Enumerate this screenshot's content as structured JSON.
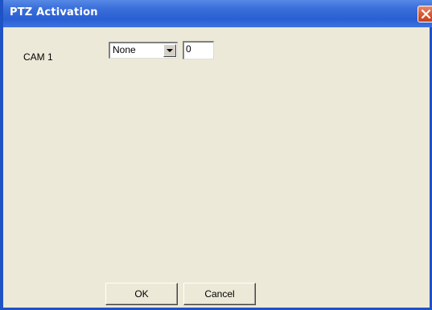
{
  "window": {
    "title": "PTZ Activation",
    "accent": "#2a5fd3",
    "background": "#ece9d8"
  },
  "titlebar": {
    "close_icon": "close-icon"
  },
  "form": {
    "cam_label": "CAM 1",
    "ptz_select_value": "None",
    "number_value": "0"
  },
  "buttons": {
    "ok_label": "OK",
    "cancel_label": "Cancel"
  }
}
